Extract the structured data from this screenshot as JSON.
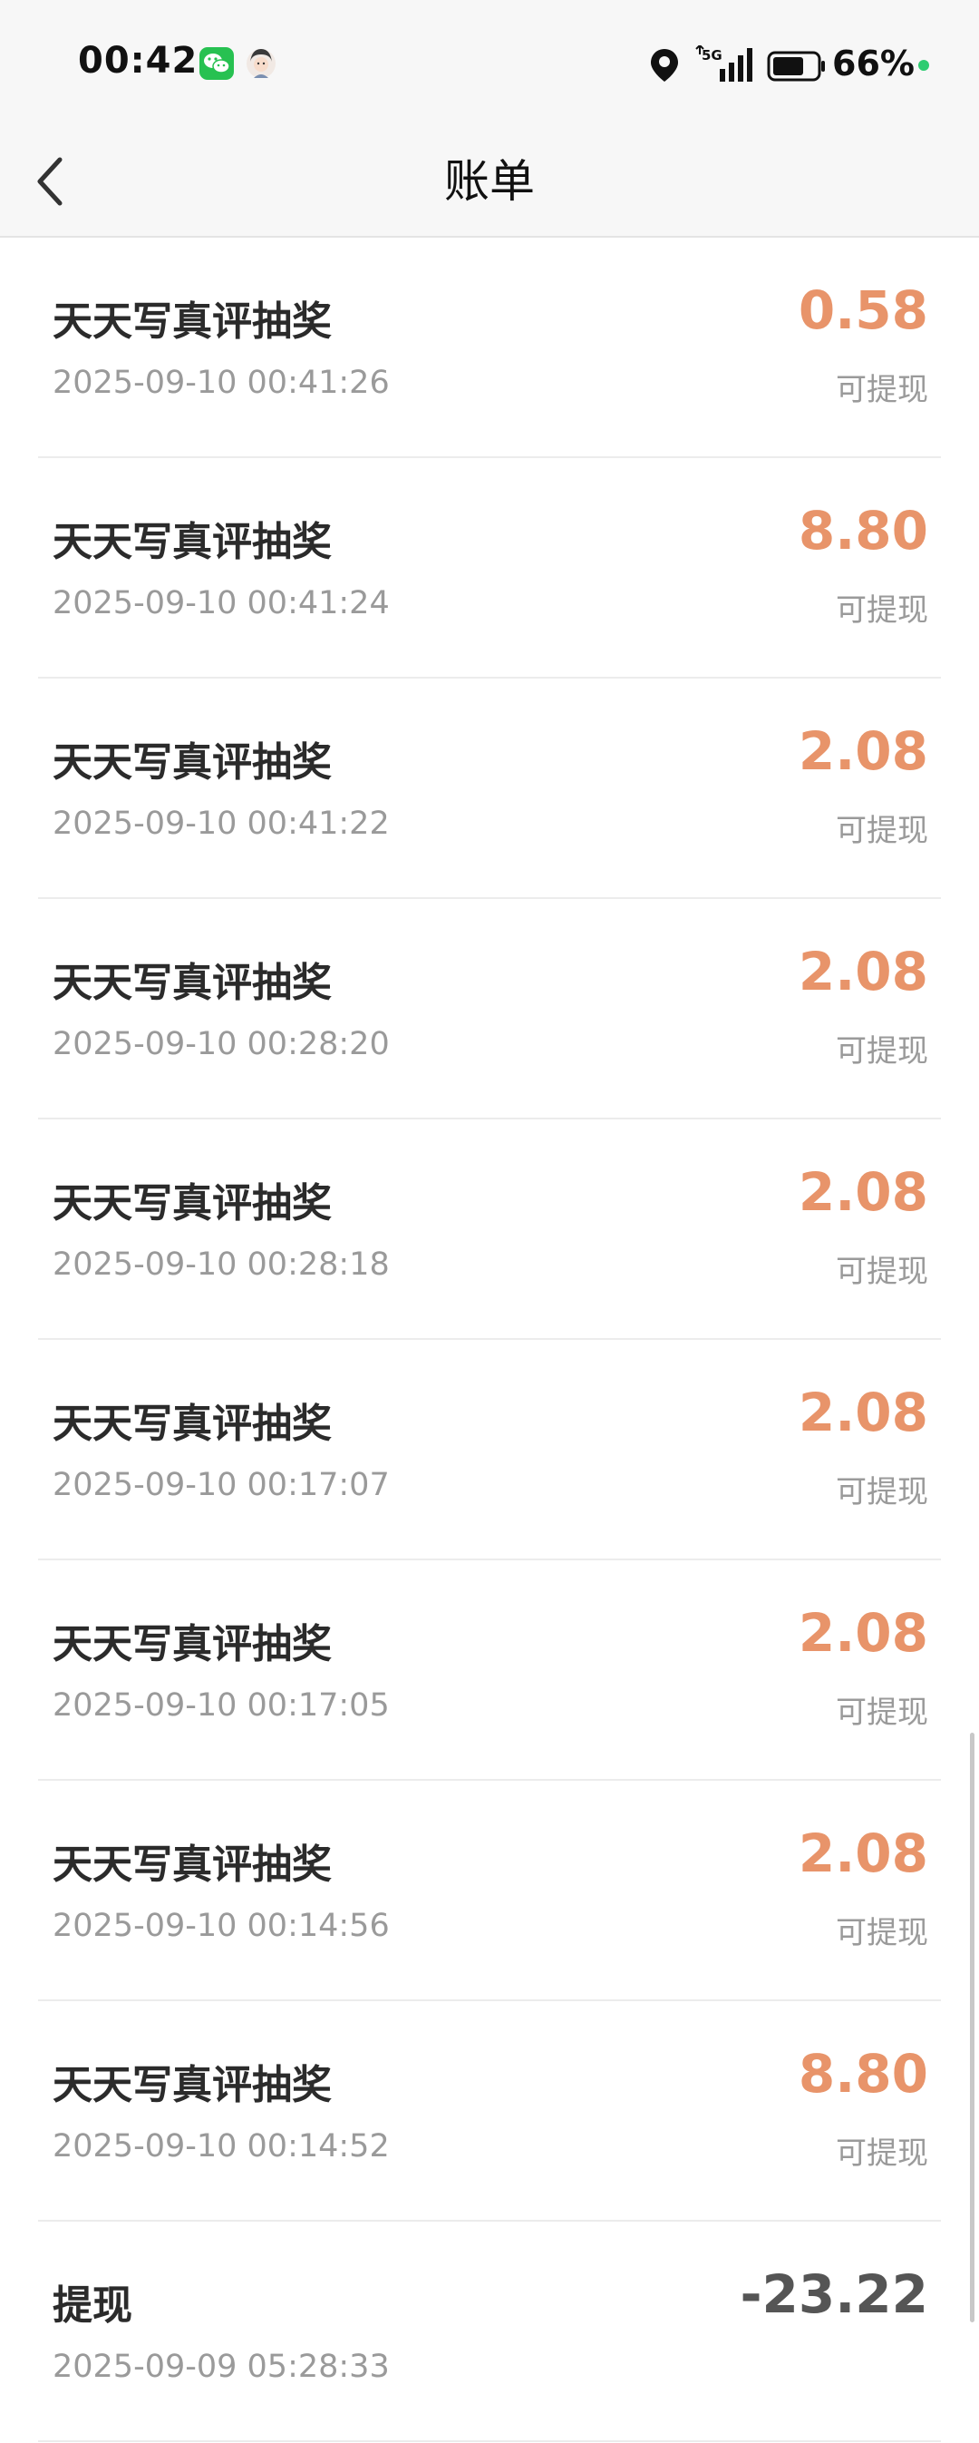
{
  "status_bar": {
    "time": "00:42",
    "network": "5G",
    "battery": "66%",
    "icons": [
      "wechat-icon",
      "avatar-icon",
      "location-icon",
      "signal-icon",
      "battery-icon"
    ]
  },
  "header": {
    "title": "账单",
    "back_icon": "chevron-left-icon"
  },
  "colors": {
    "positive_amount": "#e8946a",
    "negative_amount": "#555555",
    "secondary_text": "#9a9a9a"
  },
  "bills": [
    {
      "title": "天天写真评抽奖",
      "time": "2025-09-10 00:41:26",
      "amount": "0.58",
      "status": "可提现"
    },
    {
      "title": "天天写真评抽奖",
      "time": "2025-09-10 00:41:24",
      "amount": "8.80",
      "status": "可提现"
    },
    {
      "title": "天天写真评抽奖",
      "time": "2025-09-10 00:41:22",
      "amount": "2.08",
      "status": "可提现"
    },
    {
      "title": "天天写真评抽奖",
      "time": "2025-09-10 00:28:20",
      "amount": "2.08",
      "status": "可提现"
    },
    {
      "title": "天天写真评抽奖",
      "time": "2025-09-10 00:28:18",
      "amount": "2.08",
      "status": "可提现"
    },
    {
      "title": "天天写真评抽奖",
      "time": "2025-09-10 00:17:07",
      "amount": "2.08",
      "status": "可提现"
    },
    {
      "title": "天天写真评抽奖",
      "time": "2025-09-10 00:17:05",
      "amount": "2.08",
      "status": "可提现"
    },
    {
      "title": "天天写真评抽奖",
      "time": "2025-09-10 00:14:56",
      "amount": "2.08",
      "status": "可提现"
    },
    {
      "title": "天天写真评抽奖",
      "time": "2025-09-10 00:14:52",
      "amount": "8.80",
      "status": "可提现"
    },
    {
      "title": "提现",
      "time": "2025-09-09 05:28:33",
      "amount": "-23.22",
      "status": ""
    }
  ]
}
